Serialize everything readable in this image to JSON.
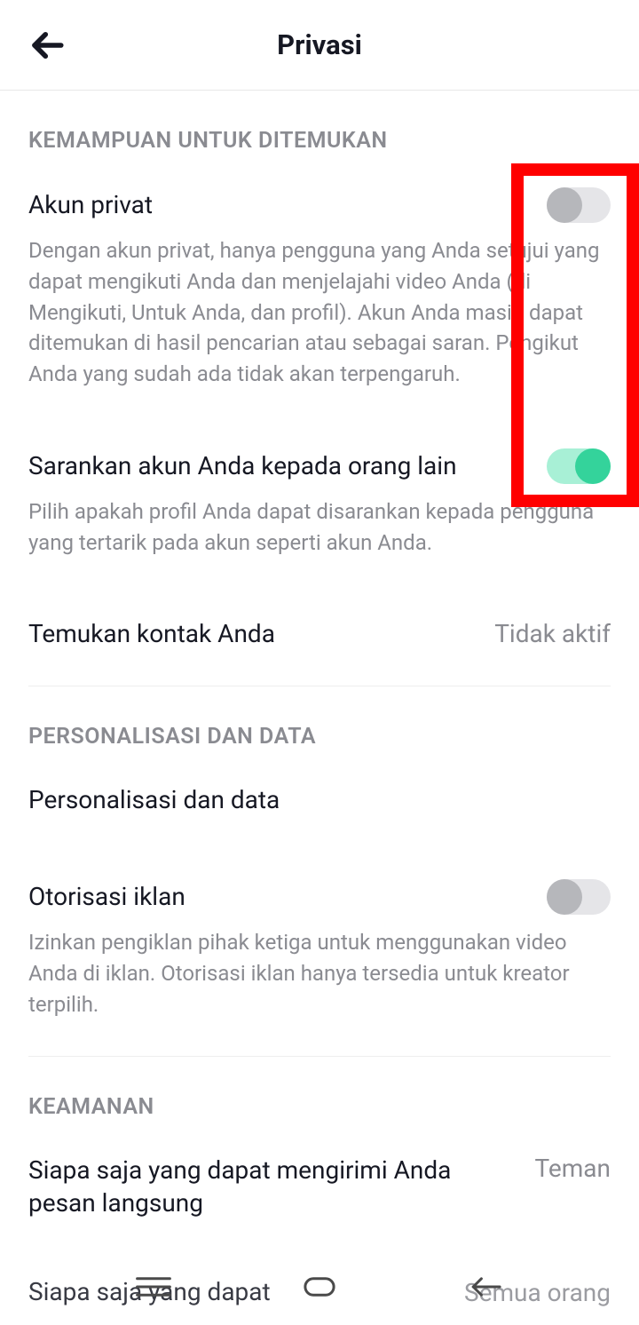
{
  "header": {
    "title": "Privasi"
  },
  "sections": {
    "discoverability": {
      "header": "KEMAMPUAN UNTUK DITEMUKAN",
      "private_account": {
        "title": "Akun privat",
        "desc": "Dengan akun privat, hanya pengguna yang Anda setujui yang dapat mengikuti Anda dan menjelajahi video Anda (di Mengikuti, Untuk Anda, dan profil). Akun Anda masih dapat ditemukan di hasil pencarian atau sebagai saran. Pengikut Anda yang sudah ada tidak akan terpengaruh.",
        "toggle": false
      },
      "suggest_account": {
        "title": "Sarankan akun Anda kepada orang lain",
        "desc": "Pilih apakah profil Anda dapat disarankan kepada pengguna yang tertarik pada akun seperti akun Anda.",
        "toggle": true
      },
      "find_contacts": {
        "title": "Temukan kontak Anda",
        "value": "Tidak aktif"
      }
    },
    "personalization": {
      "header": "PERSONALISASI DAN DATA",
      "item": {
        "title": "Personalisasi dan data"
      },
      "ad_auth": {
        "title": "Otorisasi iklan",
        "desc": "Izinkan pengiklan pihak ketiga untuk menggunakan video Anda di iklan. Otorisasi iklan hanya tersedia untuk kreator terpilih.",
        "toggle": false
      }
    },
    "security": {
      "header": "KEAMANAN",
      "dm": {
        "title": "Siapa saja yang dapat mengirimi Anda pesan langsung",
        "value": "Teman"
      },
      "next": {
        "title": "Siapa saja yang dapat",
        "value": "Semua orang"
      }
    }
  },
  "highlight": {
    "color": "#ff0000"
  }
}
